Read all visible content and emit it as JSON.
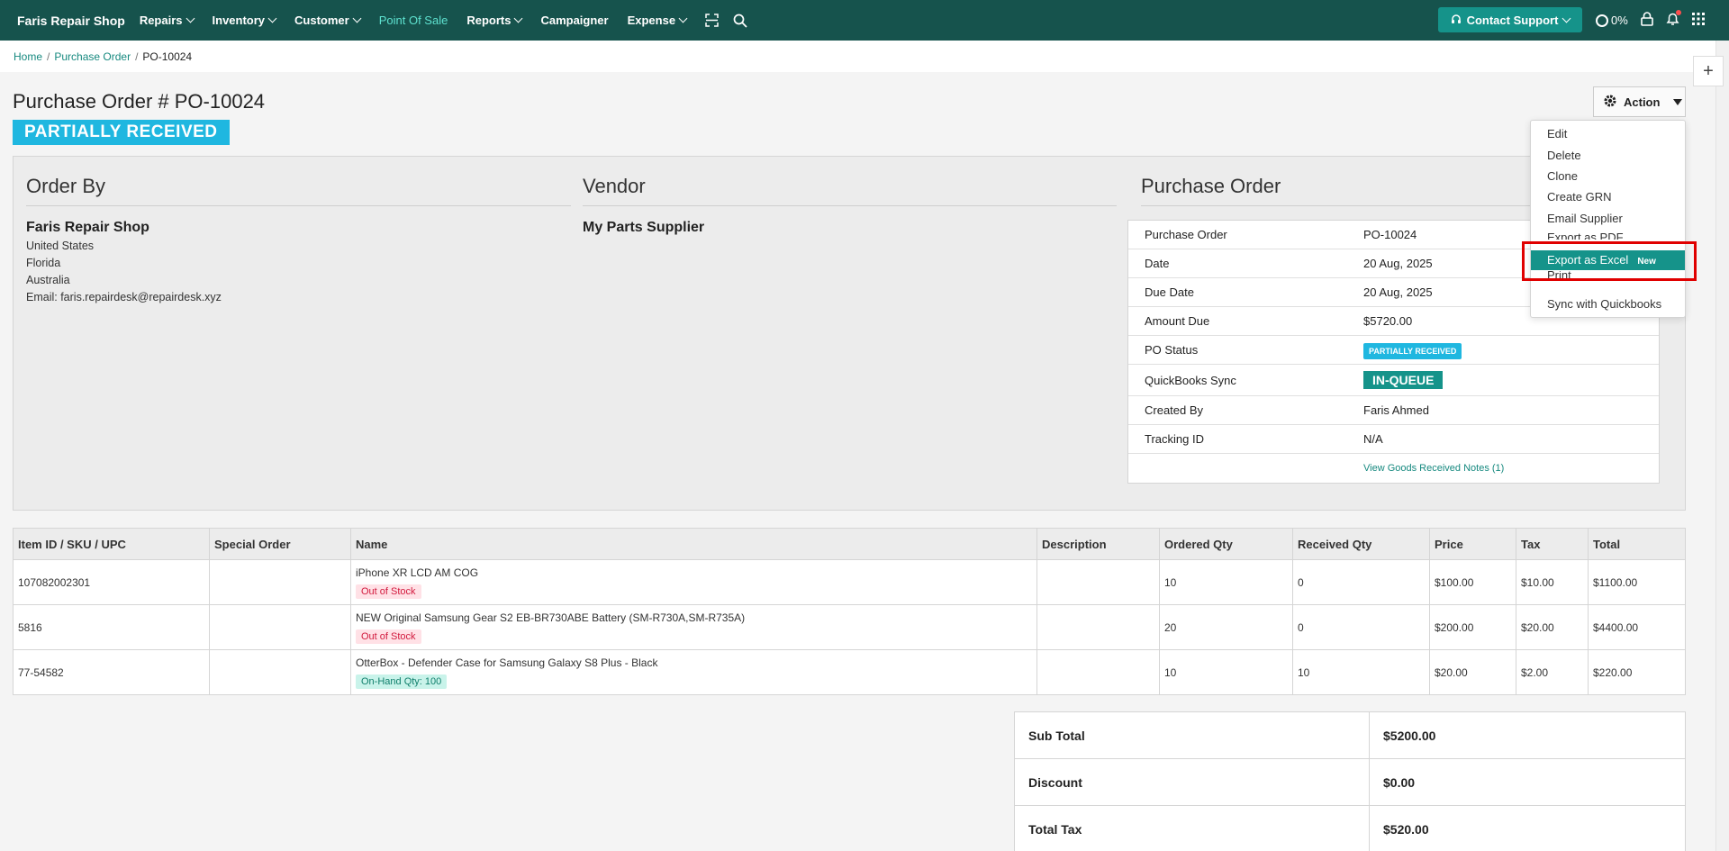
{
  "nav": {
    "brand": "Faris Repair Shop",
    "items": [
      {
        "label": "Repairs",
        "dropdown": true
      },
      {
        "label": "Inventory",
        "dropdown": true
      },
      {
        "label": "Customer",
        "dropdown": true
      },
      {
        "label": "Point Of Sale",
        "dropdown": false,
        "active": true
      },
      {
        "label": "Reports",
        "dropdown": true
      },
      {
        "label": "Campaigner",
        "dropdown": false
      },
      {
        "label": "Expense",
        "dropdown": true
      }
    ],
    "support_label": "Contact Support",
    "progress": "0%"
  },
  "breadcrumb": {
    "home": "Home",
    "section": "Purchase Order",
    "current": "PO-10024"
  },
  "title": "Purchase Order # PO-10024",
  "status": "PARTIALLY RECEIVED",
  "action_label": "Action",
  "action_menu": [
    "Edit",
    "Delete",
    "Clone",
    "Create GRN",
    "Email Supplier",
    "Export as PDF",
    "Export as Excel",
    "Print",
    "Sync with Quickbooks"
  ],
  "action_new_tag": "New",
  "order_by": {
    "heading": "Order By",
    "name": "Faris Repair Shop",
    "lines": [
      "United States",
      "Florida",
      "Australia",
      "Email: faris.repairdesk@repairdesk.xyz"
    ]
  },
  "vendor": {
    "heading": "Vendor",
    "name": "My Parts Supplier"
  },
  "po": {
    "heading": "Purchase Order",
    "rows": [
      {
        "label": "Purchase Order",
        "value": "PO-10024"
      },
      {
        "label": "Date",
        "value": "20 Aug, 2025"
      },
      {
        "label": "Due Date",
        "value": "20 Aug, 2025"
      },
      {
        "label": "Amount Due",
        "value": "$5720.00"
      },
      {
        "label": "PO Status",
        "value": "PARTIALLY RECEIVED"
      },
      {
        "label": "QuickBooks Sync",
        "value": "IN-QUEUE"
      },
      {
        "label": "Created By",
        "value": "Faris Ahmed"
      },
      {
        "label": "Tracking ID",
        "value": "N/A"
      }
    ],
    "grn_link": "View Goods Received Notes (1)"
  },
  "items_table": {
    "headers": [
      "Item ID / SKU / UPC",
      "Special Order",
      "Name",
      "Description",
      "Ordered Qty",
      "Received Qty",
      "Price",
      "Tax",
      "Total"
    ],
    "rows": [
      {
        "sku": "107082002301",
        "special": "",
        "name": "iPhone XR LCD AM COG",
        "tag": "Out of Stock",
        "tag_type": "oos",
        "desc": "",
        "ordered": "10",
        "received": "0",
        "price": "$100.00",
        "tax": "$10.00",
        "total": "$1100.00"
      },
      {
        "sku": "5816",
        "special": "",
        "name": "NEW Original Samsung Gear S2 EB-BR730ABE Battery (SM-R730A,SM-R735A)",
        "tag": "Out of Stock",
        "tag_type": "oos",
        "desc": "",
        "ordered": "20",
        "received": "0",
        "price": "$200.00",
        "tax": "$20.00",
        "total": "$4400.00"
      },
      {
        "sku": "77-54582",
        "special": "",
        "name": "OtterBox - Defender Case for Samsung Galaxy S8 Plus - Black",
        "tag": "On-Hand Qty: 100",
        "tag_type": "onhand",
        "desc": "",
        "ordered": "10",
        "received": "10",
        "price": "$20.00",
        "tax": "$2.00",
        "total": "$220.00"
      }
    ]
  },
  "totals": [
    {
      "label": "Sub Total",
      "value": "$5200.00"
    },
    {
      "label": "Discount",
      "value": "$0.00"
    },
    {
      "label": "Total Tax",
      "value": "$520.00"
    }
  ],
  "colors": {
    "nav_bg": "#16534d",
    "accent": "#15938a",
    "status_blue": "#1fb7e0",
    "highlight_box": "#e00000"
  }
}
